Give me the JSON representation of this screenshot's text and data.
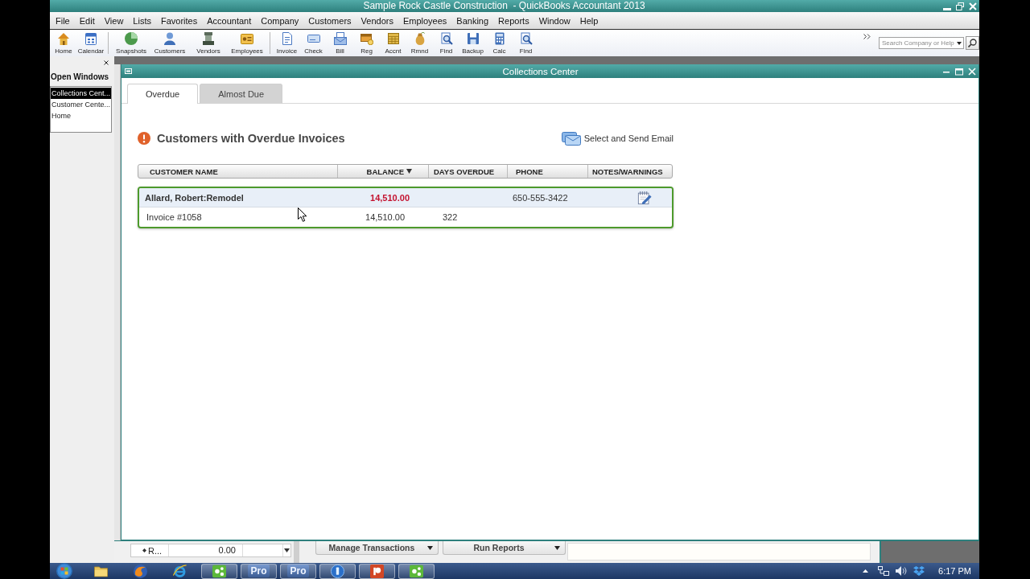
{
  "window": {
    "title": "Sample Rock Castle Construction  - QuickBooks Accountant 2013"
  },
  "menu": [
    "File",
    "Edit",
    "View",
    "Lists",
    "Favorites",
    "Accountant",
    "Company",
    "Customers",
    "Vendors",
    "Employees",
    "Banking",
    "Reports",
    "Window",
    "Help"
  ],
  "toolbar": {
    "groups": [
      [
        "Home",
        "Calendar"
      ],
      [
        "Snapshots",
        "Customers",
        "Vendors",
        "Employees"
      ],
      [
        "Invoice",
        "Check",
        "Bill",
        "Reg",
        "Accnt",
        "Rmnd",
        "Find",
        "Backup",
        "Calc",
        "Find"
      ]
    ],
    "search": {
      "placeholder": "Search Company or Help"
    }
  },
  "open_windows": {
    "title": "Open Windows",
    "items": [
      {
        "label": "Collections Cent...",
        "selected": true
      },
      {
        "label": "Customer Cente...",
        "selected": false
      },
      {
        "label": "Home",
        "selected": false
      }
    ]
  },
  "collections_center": {
    "title": "Collections Center",
    "tabs": [
      {
        "label": "Overdue",
        "selected": true
      },
      {
        "label": "Almost Due",
        "selected": false
      }
    ],
    "heading": "Customers with Overdue Invoices",
    "email_link": "Select and Send Email",
    "table": {
      "columns": [
        {
          "label": "CUSTOMER NAME",
          "sorted": false
        },
        {
          "label": "BALANCE",
          "sorted": true
        },
        {
          "label": "DAYS OVERDUE",
          "sorted": false
        },
        {
          "label": "PHONE",
          "sorted": false
        },
        {
          "label": "NOTES/WARNINGS",
          "sorted": false
        }
      ],
      "groups": [
        {
          "customer": "Allard, Robert:Remodel",
          "balance": "14,510.00",
          "phone": "650-555-3422",
          "notes": true,
          "selected": true,
          "invoices": [
            {
              "name": "Invoice #1058",
              "balance": "14,510.00",
              "days_overdue": "322"
            }
          ]
        }
      ]
    }
  },
  "background_window": {
    "row": {
      "column_1": "R...",
      "column_2": "0.00"
    },
    "buttons": [
      "Manage Transactions",
      "Run Reports"
    ]
  },
  "taskbar": {
    "apps": [
      {
        "open": false
      },
      {
        "open": false
      },
      {
        "open": false
      },
      {
        "open": true
      },
      {
        "open": true,
        "label": "Pro"
      },
      {
        "open": true,
        "label": "Pro"
      },
      {
        "open": true
      },
      {
        "open": true
      },
      {
        "open": true
      }
    ],
    "clock": "6:17 PM"
  }
}
